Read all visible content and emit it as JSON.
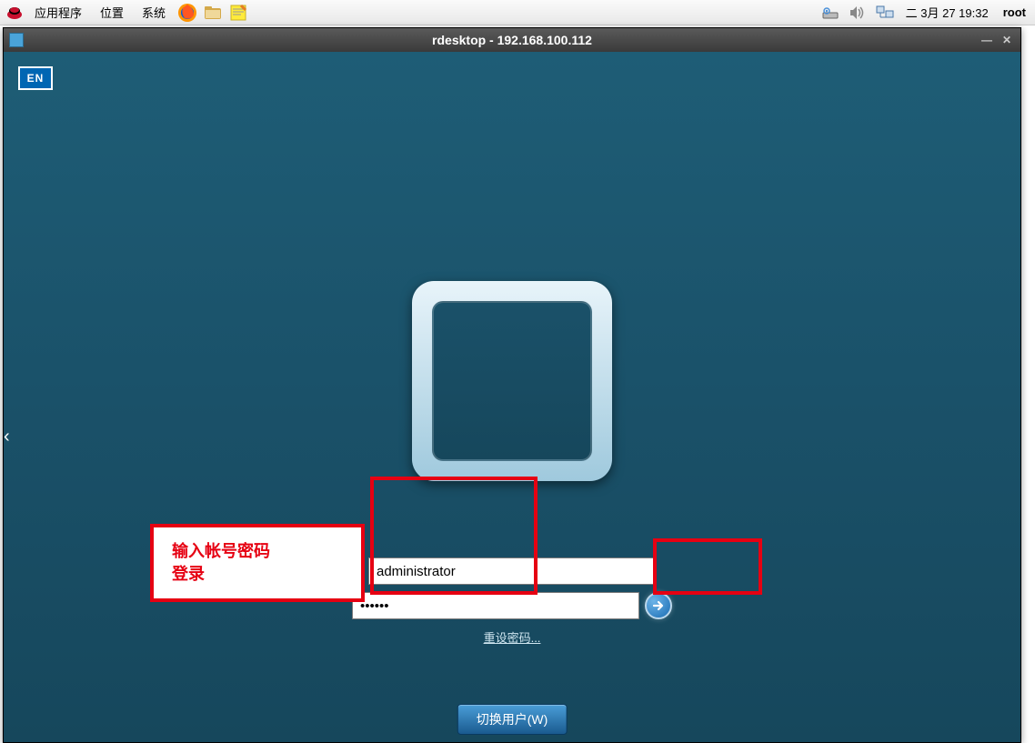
{
  "panel": {
    "menus": {
      "apps": "应用程序",
      "places": "位置",
      "system": "系统"
    },
    "clock": "二  3月 27 19:32",
    "user": "root"
  },
  "window": {
    "title": "rdesktop - 192.168.100.112"
  },
  "login": {
    "lang_badge": "EN",
    "username": "administrator",
    "password": "••••••",
    "reset_link": "重设密码...",
    "switch_user": "切换用户(W)"
  },
  "annotation": {
    "label_line1": "输入帐号密码",
    "label_line2": "登录"
  }
}
